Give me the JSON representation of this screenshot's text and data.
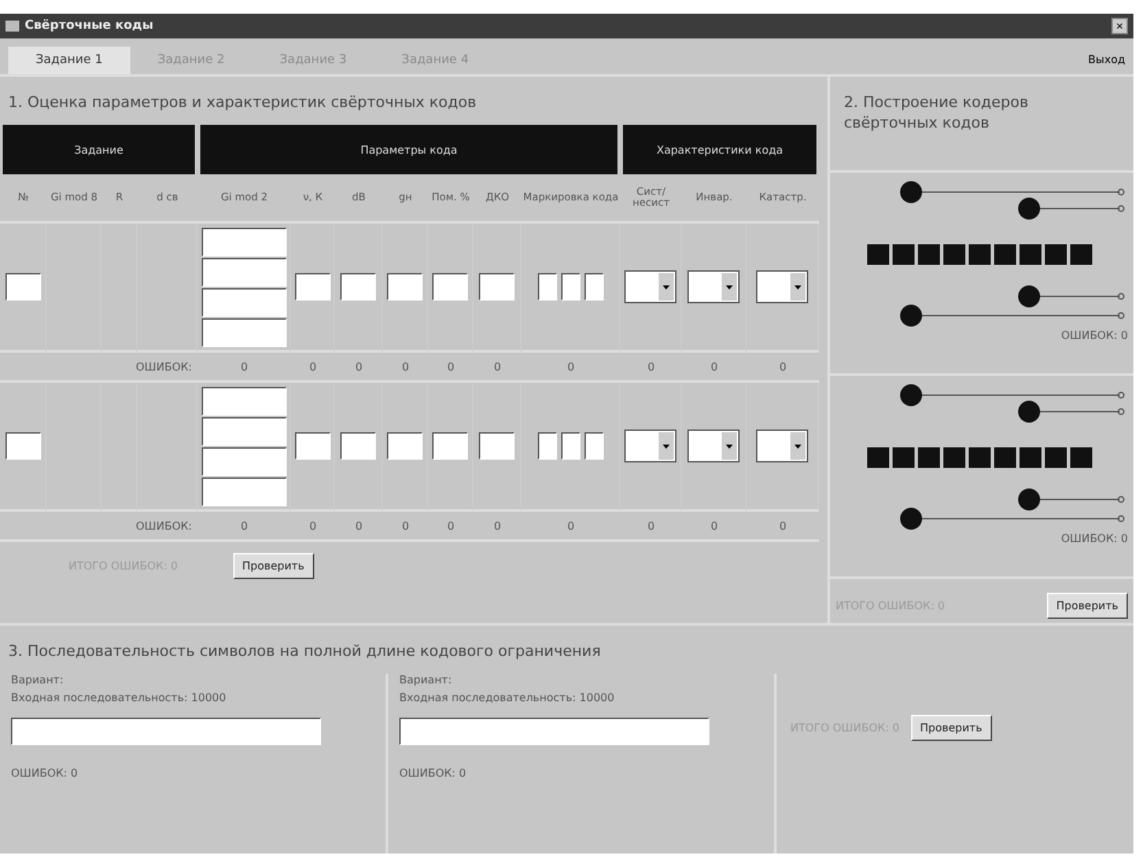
{
  "window": {
    "title": "Свёрточные коды",
    "close": "×"
  },
  "tabs": [
    {
      "label": "Задание 1",
      "selected": true,
      "disabled": false
    },
    {
      "label": "Задание 2",
      "selected": false,
      "disabled": true
    },
    {
      "label": "Задание 3",
      "selected": false,
      "disabled": true
    },
    {
      "label": "Задание 4",
      "selected": false,
      "disabled": true
    }
  ],
  "exit": "Выход",
  "section1": {
    "title": "1. Оценка параметров и характеристик свёрточных кодов",
    "groups": [
      {
        "label": "Задание"
      },
      {
        "label": "Параметры кода"
      },
      {
        "label": "Характеристики кода"
      }
    ],
    "columns": [
      {
        "label": "№",
        "kind": "number"
      },
      {
        "label": "Gi mod 8",
        "kind": "none"
      },
      {
        "label": "R",
        "kind": "none"
      },
      {
        "label": "d св",
        "kind": "none"
      },
      {
        "label": "Gi mod 2",
        "kind": "stack"
      },
      {
        "label": "ν, К",
        "kind": "input"
      },
      {
        "label": "dB",
        "kind": "input"
      },
      {
        "label": "gн",
        "kind": "input"
      },
      {
        "label": "Пом. %",
        "kind": "input"
      },
      {
        "label": "ДКО",
        "kind": "input"
      },
      {
        "label": "Маркировка кода",
        "kind": "marking"
      },
      {
        "label": "Сист/ несист",
        "kind": "select"
      },
      {
        "label": "Инвар.",
        "kind": "select"
      },
      {
        "label": "Катастр.",
        "kind": "select"
      }
    ],
    "rows": [
      {
        "errors_label": "ОШИБОК:",
        "errors": [
          "0",
          "0",
          "0",
          "0",
          "0",
          "0",
          "0",
          "0",
          "0",
          "0"
        ]
      },
      {
        "errors_label": "ОШИБОК:",
        "errors": [
          "0",
          "0",
          "0",
          "0",
          "0",
          "0",
          "0",
          "0",
          "0",
          "0"
        ]
      }
    ],
    "total": {
      "label": "ИТОГО ОШИБОК:",
      "value": "0",
      "disabled": true
    },
    "check": "Проверить"
  },
  "section2": {
    "title": "2. Построение кодеров свёрточных кодов",
    "coders": [
      {
        "errors": "ОШИБОК: 0"
      },
      {
        "errors": "ОШИБОК: 0"
      }
    ],
    "total": {
      "label": "ИТОГО ОШИБОК:",
      "value": "0",
      "disabled": true
    },
    "check": "Проверить"
  },
  "section3": {
    "title": "3. Последовательность символов на полной длине кодового ограничения",
    "variants": [
      {
        "label": "Вариант:",
        "input": "Входная последовательность: 10000",
        "errors": "ОШИБОК: 0"
      },
      {
        "label": "Вариант:",
        "input": "Входная последовательность: 10000",
        "errors": "ОШИБОК: 0"
      }
    ],
    "total": {
      "label": "ИТОГО ОШИБОК:",
      "value": "0",
      "disabled": true
    },
    "check": "Проверить"
  }
}
